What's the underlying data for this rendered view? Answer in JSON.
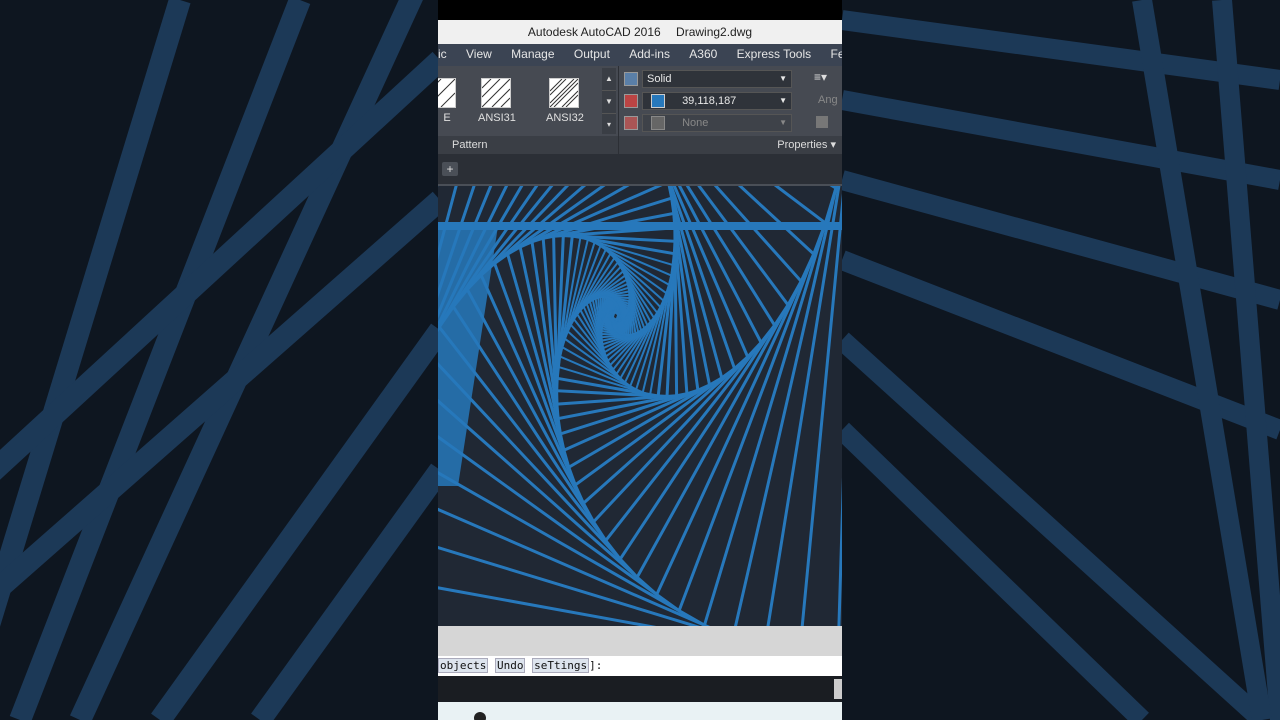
{
  "window": {
    "app_title": "Autodesk AutoCAD 2016",
    "file_name": "Drawing2.dwg"
  },
  "menu": [
    "ic",
    "View",
    "Manage",
    "Output",
    "Add-ins",
    "A360",
    "Express Tools",
    "Featured"
  ],
  "ribbon": {
    "patterns": [
      {
        "label": "E"
      },
      {
        "label": "ANSI31"
      },
      {
        "label": "ANSI32"
      }
    ],
    "pattern_panel_label": "Pattern",
    "properties_panel_label": "Properties",
    "hatch_type": "Solid",
    "hatch_color": "39,118,187",
    "background_color": "None",
    "angle_label": "Ang"
  },
  "colors": {
    "accent_blue": "#2778bb",
    "canvas_bg": "#202834"
  },
  "command_line": {
    "prefix": "",
    "options": [
      "objects",
      "Undo",
      "seTtings"
    ],
    "suffix": "]:"
  },
  "tab_add_label": "+",
  "icons": [
    "plus-icon",
    "chevron-down-icon",
    "hatch-swatch-icon",
    "layer-icon"
  ]
}
